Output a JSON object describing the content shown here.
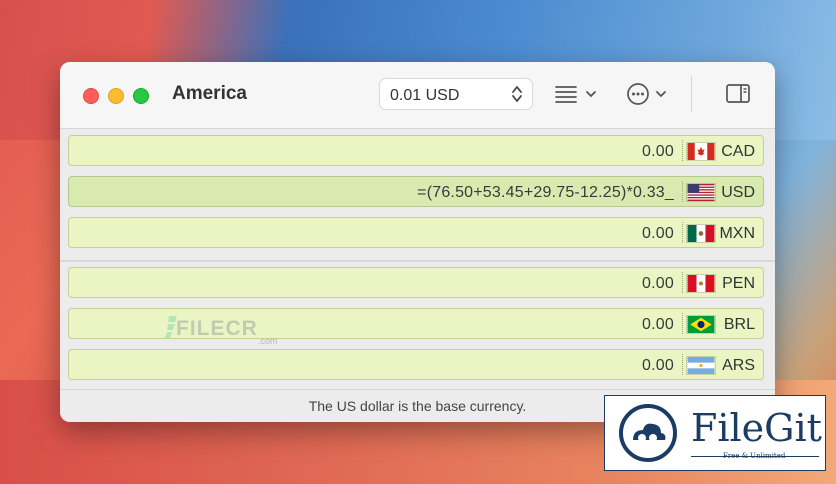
{
  "window": {
    "title": "America",
    "stepper_value": "0.01 USD",
    "footer": "The US dollar is the base currency."
  },
  "rows": [
    {
      "value": "0.00",
      "code": "CAD",
      "flag": "canada-flag-icon"
    },
    {
      "value": "=(76.50+53.45+29.75-12.25)*0.33_",
      "code": "USD",
      "flag": "usa-flag-icon"
    },
    {
      "value": "0.00",
      "code": "MXN",
      "flag": "mexico-flag-icon"
    },
    {
      "value": "0.00",
      "code": "PEN",
      "flag": "peru-flag-icon"
    },
    {
      "value": "0.00",
      "code": "BRL",
      "flag": "brazil-flag-icon"
    },
    {
      "value": "0.00",
      "code": "ARS",
      "flag": "argentina-flag-icon"
    }
  ],
  "watermark": {
    "text": "FILECR",
    "sub": ".com"
  },
  "badge": {
    "name": "FileGit",
    "tagline": "Free & Unlimited"
  },
  "colors": {
    "row_bg": "#eaf5c3",
    "row_active": "#d9eab0"
  }
}
